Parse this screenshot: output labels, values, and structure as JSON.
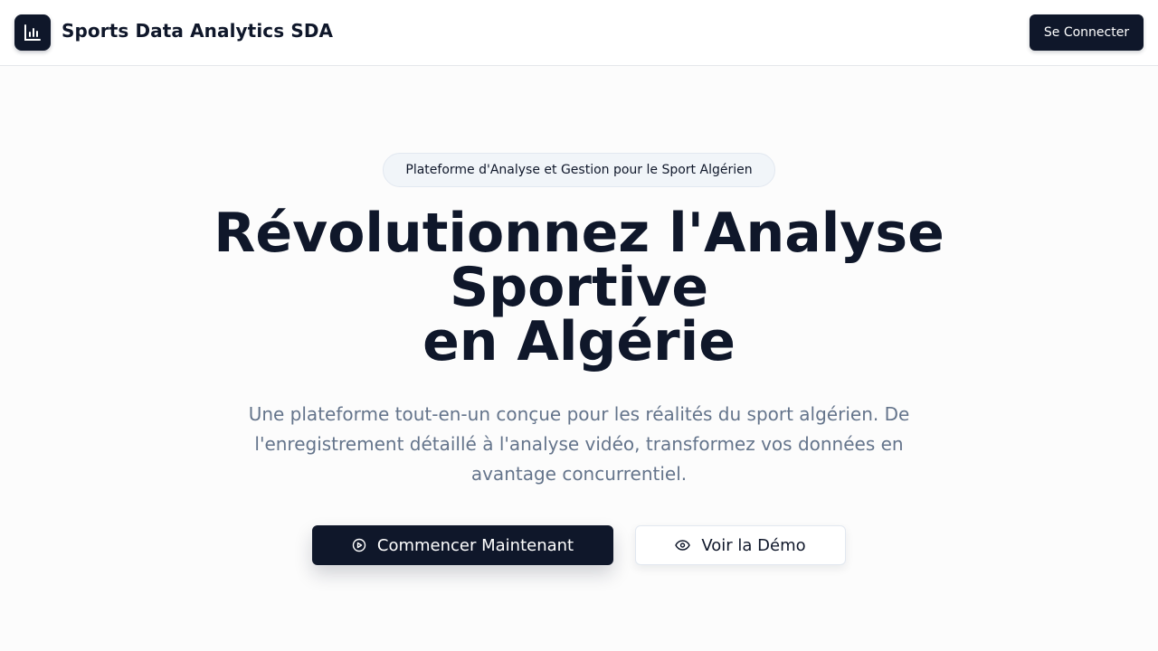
{
  "header": {
    "brand": "Sports Data Analytics SDA",
    "logo_icon": "bar-chart-icon",
    "login_label": "Se Connecter"
  },
  "hero": {
    "badge": "Plateforme d'Analyse et Gestion pour le Sport Algérien",
    "headline_line1": "Révolutionnez l'Analyse",
    "headline_line2": "Sportive",
    "headline_line3": "en Algérie",
    "subtitle": "Une plateforme tout-en-un conçue pour les réalités du sport algérien. De l'enregistrement détaillé à l'analyse vidéo, transformez vos données en avantage concurrentiel.",
    "primary_cta": {
      "label": "Commencer Maintenant",
      "icon": "play-circle-icon"
    },
    "secondary_cta": {
      "label": "Voir la Démo",
      "icon": "eye-icon"
    }
  },
  "colors": {
    "primary": "#0f172a",
    "muted_text": "#64748b",
    "background": "#fcfcfc",
    "badge_bg": "#f1f5f9"
  }
}
